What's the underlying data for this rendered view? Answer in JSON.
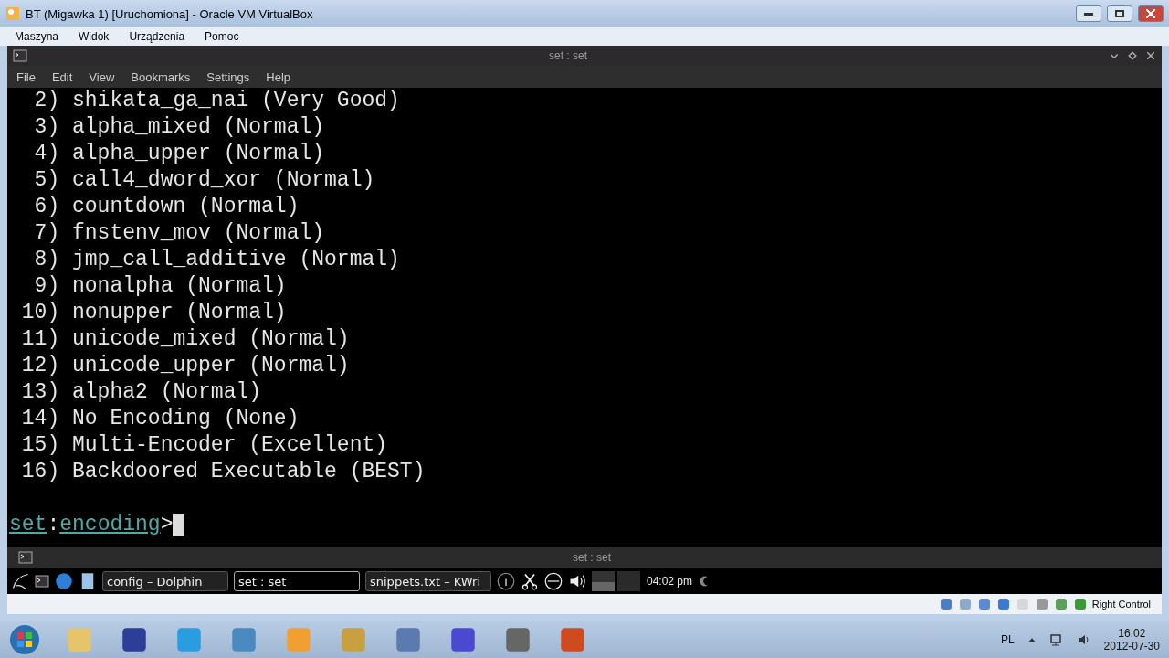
{
  "window": {
    "title": "BT (Migawka 1) [Uruchomiona] - Oracle VM VirtualBox"
  },
  "vm_menu": [
    "Maszyna",
    "Widok",
    "Urządzenia",
    "Pomoc"
  ],
  "konsole": {
    "title": "set : set",
    "menu": [
      "File",
      "Edit",
      "View",
      "Bookmarks",
      "Settings",
      "Help"
    ],
    "lines": [
      "  2) shikata_ga_nai (Very Good)",
      "  3) alpha_mixed (Normal)",
      "  4) alpha_upper (Normal)",
      "  5) call4_dword_xor (Normal)",
      "  6) countdown (Normal)",
      "  7) fnstenv_mov (Normal)",
      "  8) jmp_call_additive (Normal)",
      "  9) nonalpha (Normal)",
      " 10) nonupper (Normal)",
      " 11) unicode_mixed (Normal)",
      " 12) unicode_upper (Normal)",
      " 13) alpha2 (Normal)",
      " 14) No Encoding (None)",
      " 15) Multi-Encoder (Excellent)",
      " 16) Backdoored Executable (BEST)"
    ],
    "prompt": [
      {
        "text": "set",
        "kind": "link"
      },
      {
        "text": ":",
        "kind": "plain"
      },
      {
        "text": "encoding",
        "kind": "link"
      },
      {
        "text": ">",
        "kind": "plain"
      }
    ],
    "tab_title": "set : set"
  },
  "kde_panel": {
    "tasks": [
      {
        "label": "config – Dolphin",
        "selected": false
      },
      {
        "label": "set : set",
        "selected": true
      },
      {
        "label": "snippets.txt – KWri",
        "selected": false
      }
    ],
    "clock": "04:02 pm"
  },
  "vm_status": {
    "host_key": "Right Control"
  },
  "taskbar": {
    "language": "PL",
    "time": "16:02",
    "date": "2012-07-30"
  }
}
